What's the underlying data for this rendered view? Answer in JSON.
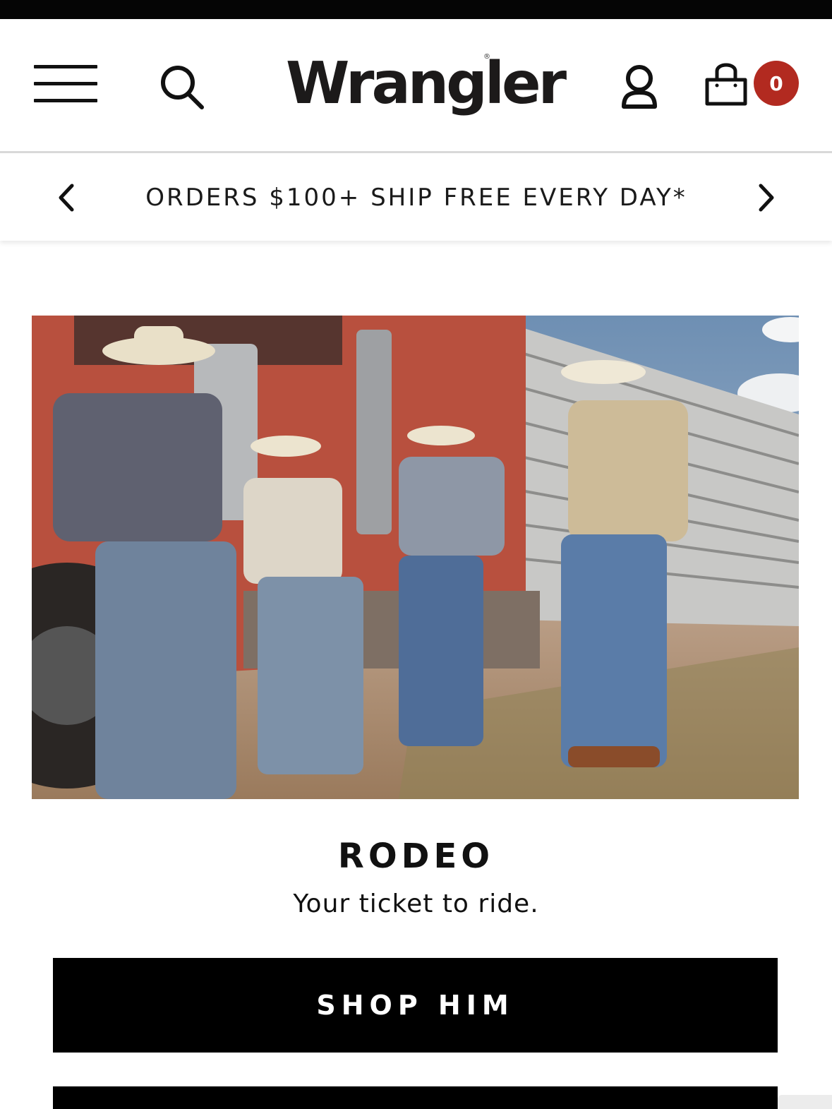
{
  "header": {
    "logo_text": "Wrangler",
    "logo_mark": "®",
    "cart_count": "0",
    "icons": [
      "hamburger-menu-icon",
      "search-icon",
      "user-account-icon",
      "shopping-bag-icon"
    ]
  },
  "promo_bar": {
    "text": "ORDERS $100+ SHIP FREE EVERY DAY*",
    "icons": [
      "chevron-left-icon",
      "chevron-right-icon"
    ]
  },
  "hero": {
    "title": "RODEO",
    "subtitle": "Your ticket to ride.",
    "cta_label": "SHOP HIM"
  },
  "colors": {
    "accent_red": "#b22a20",
    "button_black": "#000000",
    "text_dark": "#111111"
  }
}
